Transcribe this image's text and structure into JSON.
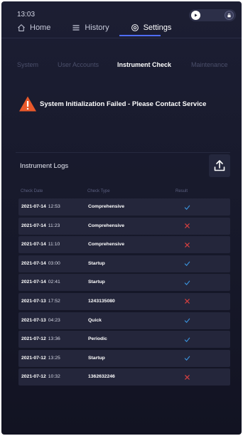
{
  "status": {
    "time": "13:03"
  },
  "nav": {
    "home": "Home",
    "history": "History",
    "settings": "Settings"
  },
  "subtabs": {
    "system": "System",
    "user_accounts": "User Accounts",
    "instrument_check": "Instrument Check",
    "maintenance": "Maintenance"
  },
  "alert": {
    "message": "System Initialization Failed - Please Contact Service",
    "color": "#e8592b"
  },
  "logs": {
    "title": "Instrument Logs",
    "columns": {
      "date": "Check Date",
      "type": "Check Type",
      "result": "Result"
    },
    "rows": [
      {
        "date": "2021-07-14",
        "time": "12:53",
        "type": "Comprehensive",
        "result": "pass"
      },
      {
        "date": "2021-07-14",
        "time": "11:23",
        "type": "Comprehensive",
        "result": "fail"
      },
      {
        "date": "2021-07-14",
        "time": "11:10",
        "type": "Comprehensive",
        "result": "fail"
      },
      {
        "date": "2021-07-14",
        "time": "03:00",
        "type": "Startup",
        "result": "pass"
      },
      {
        "date": "2021-07-14",
        "time": "02:41",
        "type": "Startup",
        "result": "pass"
      },
      {
        "date": "2021-07-13",
        "time": "17:52",
        "type": "1243135080",
        "result": "fail"
      },
      {
        "date": "2021-07-13",
        "time": "04:23",
        "type": "Quick",
        "result": "pass"
      },
      {
        "date": "2021-07-12",
        "time": "13:36",
        "type": "Periodic",
        "result": "pass"
      },
      {
        "date": "2021-07-12",
        "time": "13:25",
        "type": "Startup",
        "result": "pass"
      },
      {
        "date": "2021-07-12",
        "time": "10:32",
        "type": "1362632246",
        "result": "fail"
      }
    ]
  },
  "colors": {
    "accent": "#4f6dff",
    "pass": "#3a8fd6",
    "fail": "#d94040"
  },
  "icons": {
    "home": "home-icon",
    "history": "list-icon",
    "settings": "gear-icon",
    "upload": "upload-icon",
    "alert": "warning-triangle-icon"
  }
}
